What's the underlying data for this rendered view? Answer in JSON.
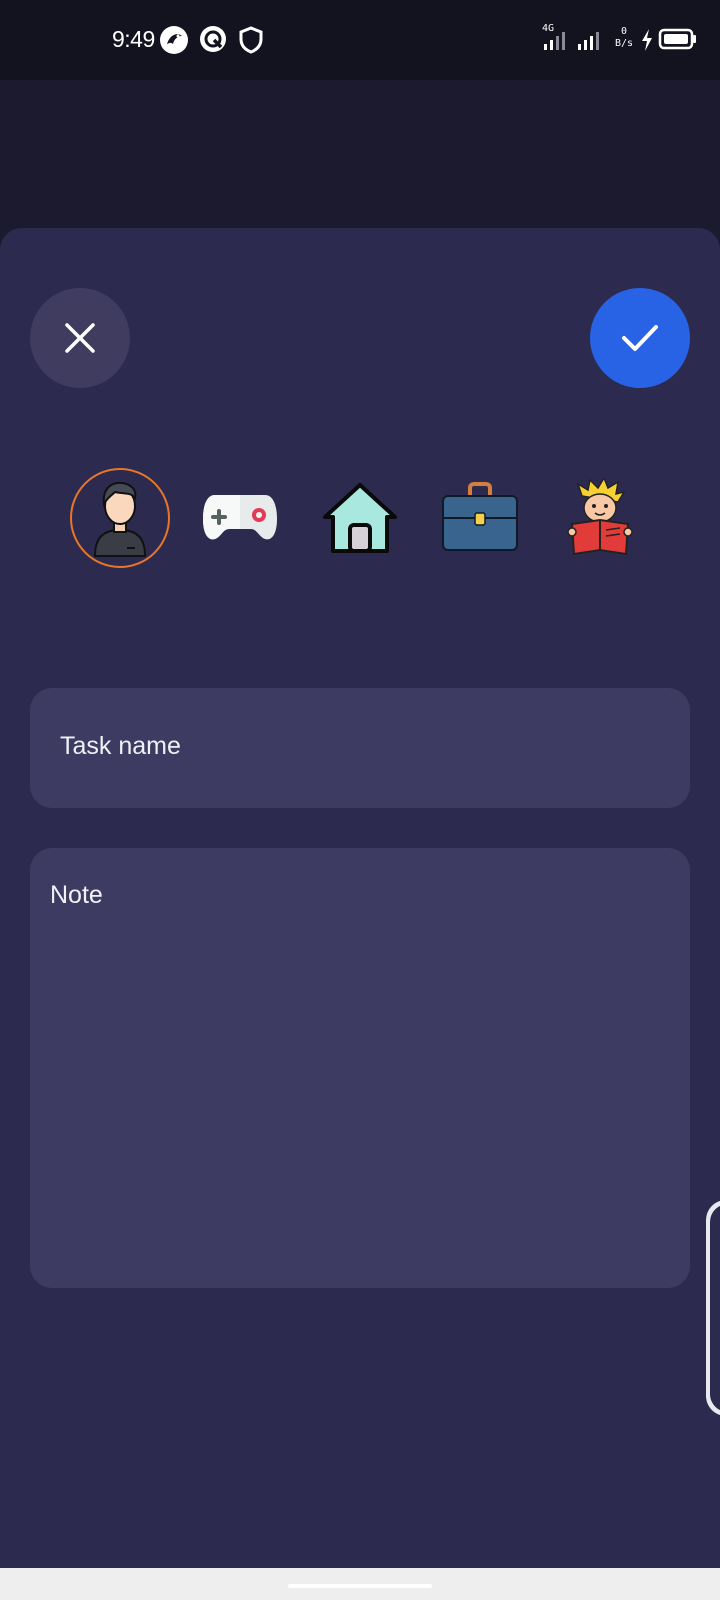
{
  "status_bar": {
    "time": "9:49",
    "network": "4G",
    "speed_value": "0",
    "speed_unit": "B/s",
    "icons": [
      "bird-app-icon",
      "q-app-icon",
      "shield-icon",
      "signal-4g-icon",
      "signal-icon",
      "charging-icon",
      "battery-icon"
    ]
  },
  "sheet": {
    "close_icon": "close-icon",
    "confirm_icon": "check-icon",
    "categories": [
      {
        "name": "person",
        "icon": "person-avatar-icon",
        "selected": true
      },
      {
        "name": "game",
        "icon": "gamepad-icon",
        "selected": false
      },
      {
        "name": "home",
        "icon": "house-icon",
        "selected": false
      },
      {
        "name": "work",
        "icon": "briefcase-icon",
        "selected": false
      },
      {
        "name": "study",
        "icon": "reading-kid-icon",
        "selected": false
      }
    ],
    "task_name_placeholder": "Task name",
    "note_placeholder": "Note"
  },
  "colors": {
    "sheet_bg": "#2d2a50",
    "field_bg": "#3e3b63",
    "confirm_accent": "#2863e6",
    "selected_ring": "#e8762a"
  }
}
